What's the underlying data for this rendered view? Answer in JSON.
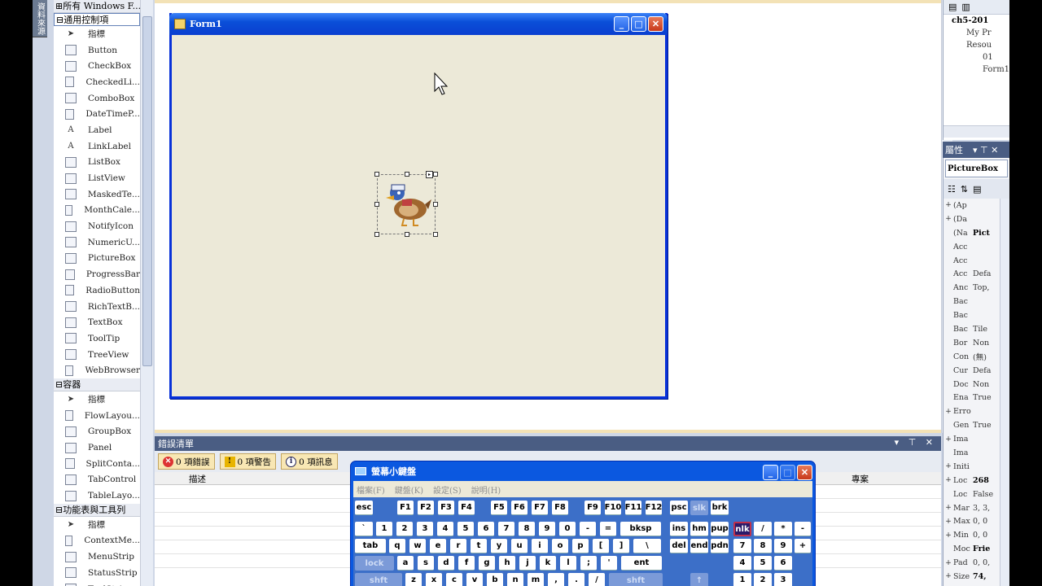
{
  "toolbox": {
    "side_tab": "資料來源",
    "categories": {
      "all": "所有 Windows F...",
      "common": "通用控制項",
      "containers": "容器",
      "menus": "功能表與工具列"
    },
    "common_items": [
      "指標",
      "Button",
      "CheckBox",
      "CheckedLi...",
      "ComboBox",
      "DateTimeP...",
      "Label",
      "LinkLabel",
      "ListBox",
      "ListView",
      "MaskedTe...",
      "MonthCale...",
      "NotifyIcon",
      "NumericU...",
      "PictureBox",
      "ProgressBar",
      "RadioButton",
      "RichTextB...",
      "TextBox",
      "ToolTip",
      "TreeView",
      "WebBrowser"
    ],
    "container_items": [
      "指標",
      "FlowLayou...",
      "GroupBox",
      "Panel",
      "SplitConta...",
      "TabControl",
      "TableLayo..."
    ],
    "menu_items": [
      "指標",
      "ContextMe...",
      "MenuStrip",
      "StatusStrip",
      "ToolStrip"
    ]
  },
  "form": {
    "title": "Form1",
    "min": "_",
    "max": "□",
    "close": "✕"
  },
  "solution": {
    "rows": [
      "ch5-201",
      "My Pr",
      "Resou",
      "01",
      "Form1"
    ]
  },
  "properties": {
    "header": "屬性",
    "header_ctrls": "▾ ⊤ ✕",
    "object": "PictureBox",
    "rows": [
      {
        "exp": "+",
        "name": "(Ap",
        "val": ""
      },
      {
        "exp": "+",
        "name": "(Da",
        "val": ""
      },
      {
        "exp": "",
        "name": "(Na",
        "val": "Pict",
        "bold": true
      },
      {
        "exp": "",
        "name": "Acc",
        "val": ""
      },
      {
        "exp": "",
        "name": "Acc",
        "val": ""
      },
      {
        "exp": "",
        "name": "Acc",
        "val": "Defa"
      },
      {
        "exp": "",
        "name": "Anc",
        "val": "Top,"
      },
      {
        "exp": "",
        "name": "Bac",
        "val": ""
      },
      {
        "exp": "",
        "name": "Bac",
        "val": ""
      },
      {
        "exp": "",
        "name": "Bac",
        "val": "Tile"
      },
      {
        "exp": "",
        "name": "Bor",
        "val": "Non"
      },
      {
        "exp": "",
        "name": "Con",
        "val": "(無)"
      },
      {
        "exp": "",
        "name": "Cur",
        "val": "Defa"
      },
      {
        "exp": "",
        "name": "Doc",
        "val": "Non"
      },
      {
        "exp": "",
        "name": "Ena",
        "val": "True"
      },
      {
        "exp": "+",
        "name": "Erro",
        "val": ""
      },
      {
        "exp": "",
        "name": "Gen",
        "val": "True"
      },
      {
        "exp": "+",
        "name": "Ima",
        "val": ""
      },
      {
        "exp": "",
        "name": "Ima",
        "val": ""
      },
      {
        "exp": "+",
        "name": "Initi",
        "val": ""
      },
      {
        "exp": "+",
        "name": "Loc",
        "val": "268",
        "bold": true
      },
      {
        "exp": "",
        "name": "Loc",
        "val": "False"
      },
      {
        "exp": "+",
        "name": "Mar",
        "val": "3, 3,"
      },
      {
        "exp": "+",
        "name": "Max",
        "val": "0, 0"
      },
      {
        "exp": "+",
        "name": "Min",
        "val": "0, 0"
      },
      {
        "exp": "",
        "name": "Moc",
        "val": "Frie",
        "bold": true
      },
      {
        "exp": "+",
        "name": "Pad",
        "val": "0, 0,"
      },
      {
        "exp": "+",
        "name": "Size",
        "val": "74,",
        "bold": true
      }
    ]
  },
  "error_list": {
    "title": "錯誤清單",
    "ctrls": "▾ ⊤ ✕",
    "errors": "0 項錯誤",
    "warnings": "0 項警告",
    "messages": "0 項訊息",
    "col_desc": "描述",
    "col_project": "專案"
  },
  "osk": {
    "title": "螢幕小鍵盤",
    "menu": [
      "檔案(F)",
      "鍵盤(K)",
      "設定(S)",
      "說明(H)"
    ]
  }
}
